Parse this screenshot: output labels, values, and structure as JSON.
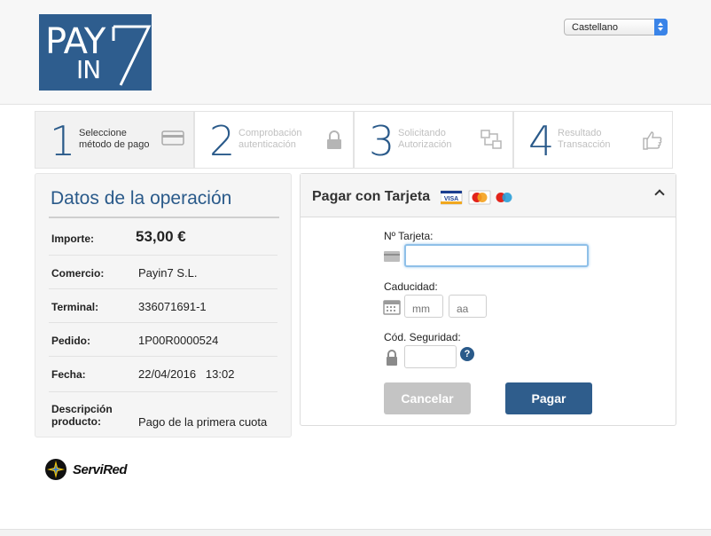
{
  "header": {
    "logo_line1": "PAY",
    "logo_line2": "IN",
    "language_selected": "Castellano"
  },
  "steps": [
    {
      "num": "1",
      "line1": "Seleccione",
      "line2": "método de pago",
      "state": "active",
      "icon": "credit-card-icon"
    },
    {
      "num": "2",
      "line1": "Comprobación",
      "line2": "autenticación",
      "state": "inactive",
      "icon": "padlock-icon"
    },
    {
      "num": "3",
      "line1": "Solicitando",
      "line2": "Autorización",
      "state": "inactive",
      "icon": "transfer-icon"
    },
    {
      "num": "4",
      "line1": "Resultado",
      "line2": "Transacción",
      "state": "inactive",
      "icon": "thumbs-up-icon"
    }
  ],
  "operation": {
    "title": "Datos de la operación",
    "rows": [
      {
        "label": "Importe:",
        "value": "53,00 €"
      },
      {
        "label": "Comercio:",
        "value": "Payin7 S.L."
      },
      {
        "label": "Terminal:",
        "value": "336071691-1"
      },
      {
        "label": "Pedido:",
        "value": "1P00R0000524"
      },
      {
        "label": "Fecha:",
        "value": "22/04/2016   13:02"
      },
      {
        "label_line1": "Descripción",
        "label_line2": "producto:",
        "value": "Pago de la primera cuota"
      }
    ]
  },
  "payment": {
    "title": "Pagar con Tarjeta",
    "card_brands": [
      "VISA",
      "MasterCard",
      "Maestro"
    ],
    "card_number_label": "Nº Tarjeta:",
    "card_number_value": "",
    "expiry_label": "Caducidad:",
    "month_placeholder": "mm",
    "year_placeholder": "aa",
    "cvv_label": "Cód. Seguridad:",
    "help_glyph": "?",
    "cancel_label": "Cancelar",
    "pay_label": "Pagar"
  },
  "footer": {
    "brand": "ServiRed"
  },
  "colors": {
    "brand_blue": "#2e5d8e",
    "accent_blue": "#2a5a8a",
    "disabled_grey": "#c4c4c4"
  }
}
